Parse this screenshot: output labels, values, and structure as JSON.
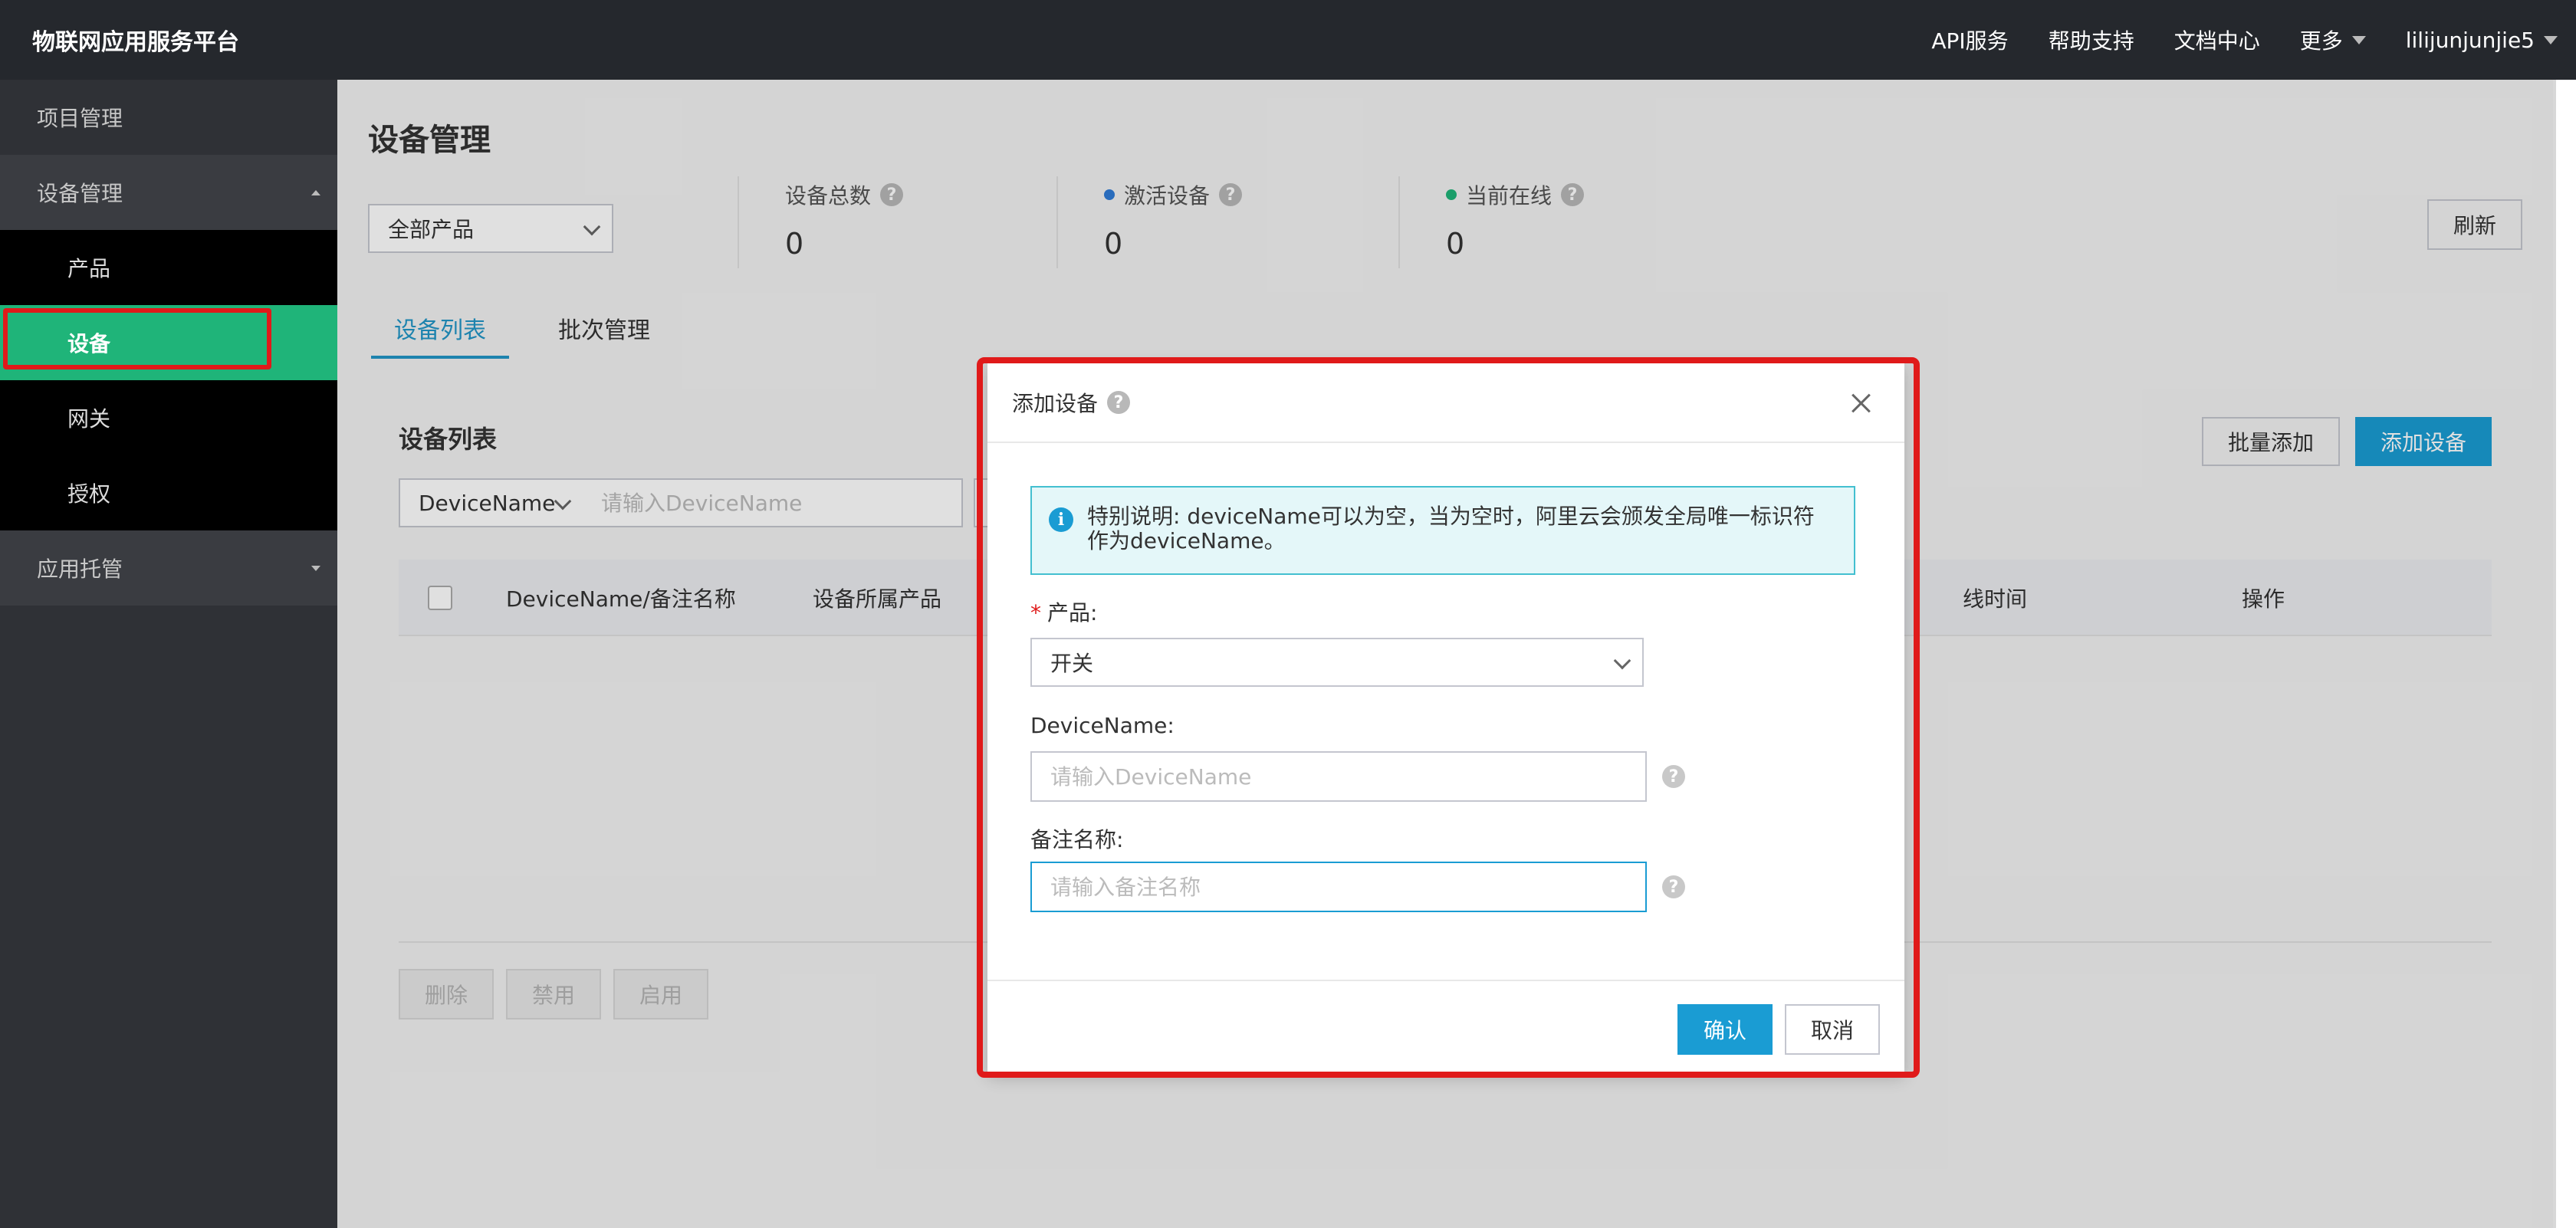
{
  "topbar": {
    "brand": "物联网应用服务平台",
    "nav": [
      {
        "label": "API服务"
      },
      {
        "label": "帮助支持"
      },
      {
        "label": "文档中心"
      },
      {
        "label": "更多"
      },
      {
        "label": "lilijunjunjie5"
      }
    ]
  },
  "sidebar": {
    "groups": [
      {
        "label": "项目管理"
      },
      {
        "label": "设备管理"
      },
      {
        "label": "应用托管"
      }
    ],
    "subitems": [
      {
        "label": "产品"
      },
      {
        "label": "设备"
      },
      {
        "label": "网关"
      },
      {
        "label": "授权"
      }
    ]
  },
  "main": {
    "title": "设备管理",
    "product_filter": "全部产品",
    "stats": [
      {
        "label": "设备总数",
        "value": "0"
      },
      {
        "label": "激活设备",
        "value": "0",
        "color": "#2f7bd6"
      },
      {
        "label": "当前在线",
        "value": "0",
        "color": "#1fb479"
      }
    ],
    "refresh_label": "刷新",
    "tabs": [
      {
        "label": "设备列表"
      },
      {
        "label": "批次管理"
      }
    ],
    "section_title": "设备列表",
    "batch_add_label": "批量添加",
    "add_device_label": "添加设备",
    "search": {
      "type": "DeviceName",
      "placeholder": "请输入DeviceName"
    },
    "table": {
      "columns": [
        "DeviceName/备注名称",
        "设备所属产品",
        "线时间",
        "操作"
      ]
    },
    "footer_buttons": [
      "删除",
      "禁用",
      "启用"
    ]
  },
  "dialog": {
    "title": "添加设备",
    "notice_line1": "特别说明: deviceName可以为空，当为空时，阿里云会颁发全局唯一标识符",
    "notice_line2": "作为deviceName。",
    "product_label": "产品:",
    "product_value": "开关",
    "devicename_label": "DeviceName:",
    "devicename_placeholder": "请输入DeviceName",
    "remark_label": "备注名称:",
    "remark_placeholder": "请输入备注名称",
    "ok_label": "确认",
    "cancel_label": "取消"
  },
  "colors": {
    "accent": "#1a9cd3",
    "active_green": "#1fb479",
    "highlight_red": "#e01a1a"
  }
}
